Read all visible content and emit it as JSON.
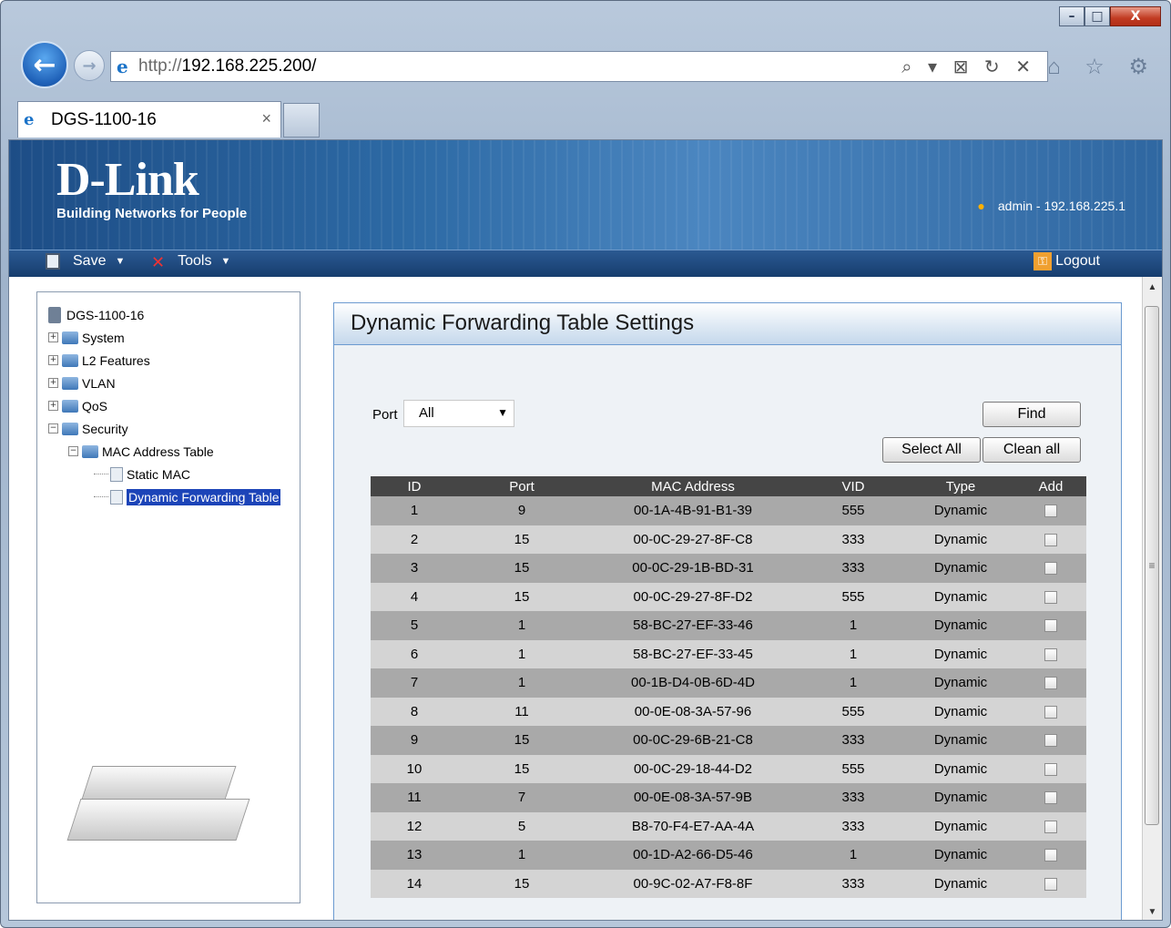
{
  "browser": {
    "url_scheme": "http://",
    "url_host": "192.168.225.200/",
    "tab_title": "DGS-1100-16",
    "tab_close": "×",
    "window_buttons": [
      "–",
      "□",
      "X"
    ],
    "addr_icons": "⌕ ▾ ⊠ ↻ ✕",
    "tool_icons": "⌂ ☆ ⚙"
  },
  "banner": {
    "logo": "D-Link",
    "tagline": "Building Networks for People",
    "user": "admin - 192.168.225.1"
  },
  "menu": {
    "save": "Save",
    "tools": "Tools",
    "logout": "Logout"
  },
  "tree": {
    "root": "DGS-1100-16",
    "system": "System",
    "l2": "L2 Features",
    "vlan": "VLAN",
    "qos": "QoS",
    "security": "Security",
    "mac_table": "MAC Address Table",
    "static_mac": "Static MAC",
    "dynamic": "Dynamic Forwarding Table"
  },
  "main": {
    "title": "Dynamic Forwarding Table Settings",
    "port_label": "Port",
    "port_value": "All",
    "find": "Find",
    "select_all": "Select All",
    "clean_all": "Clean all"
  },
  "table": {
    "headers": [
      "ID",
      "Port",
      "MAC Address",
      "VID",
      "Type",
      "Add"
    ],
    "rows": [
      [
        "1",
        "9",
        "00-1A-4B-91-B1-39",
        "555",
        "Dynamic"
      ],
      [
        "2",
        "15",
        "00-0C-29-27-8F-C8",
        "333",
        "Dynamic"
      ],
      [
        "3",
        "15",
        "00-0C-29-1B-BD-31",
        "333",
        "Dynamic"
      ],
      [
        "4",
        "15",
        "00-0C-29-27-8F-D2",
        "555",
        "Dynamic"
      ],
      [
        "5",
        "1",
        "58-BC-27-EF-33-46",
        "1",
        "Dynamic"
      ],
      [
        "6",
        "1",
        "58-BC-27-EF-33-45",
        "1",
        "Dynamic"
      ],
      [
        "7",
        "1",
        "00-1B-D4-0B-6D-4D",
        "1",
        "Dynamic"
      ],
      [
        "8",
        "11",
        "00-0E-08-3A-57-96",
        "555",
        "Dynamic"
      ],
      [
        "9",
        "15",
        "00-0C-29-6B-21-C8",
        "333",
        "Dynamic"
      ],
      [
        "10",
        "15",
        "00-0C-29-18-44-D2",
        "555",
        "Dynamic"
      ],
      [
        "11",
        "7",
        "00-0E-08-3A-57-9B",
        "333",
        "Dynamic"
      ],
      [
        "12",
        "5",
        "B8-70-F4-E7-AA-4A",
        "333",
        "Dynamic"
      ],
      [
        "13",
        "1",
        "00-1D-A2-66-D5-46",
        "1",
        "Dynamic"
      ],
      [
        "14",
        "15",
        "00-9C-02-A7-F8-8F",
        "333",
        "Dynamic"
      ]
    ]
  }
}
